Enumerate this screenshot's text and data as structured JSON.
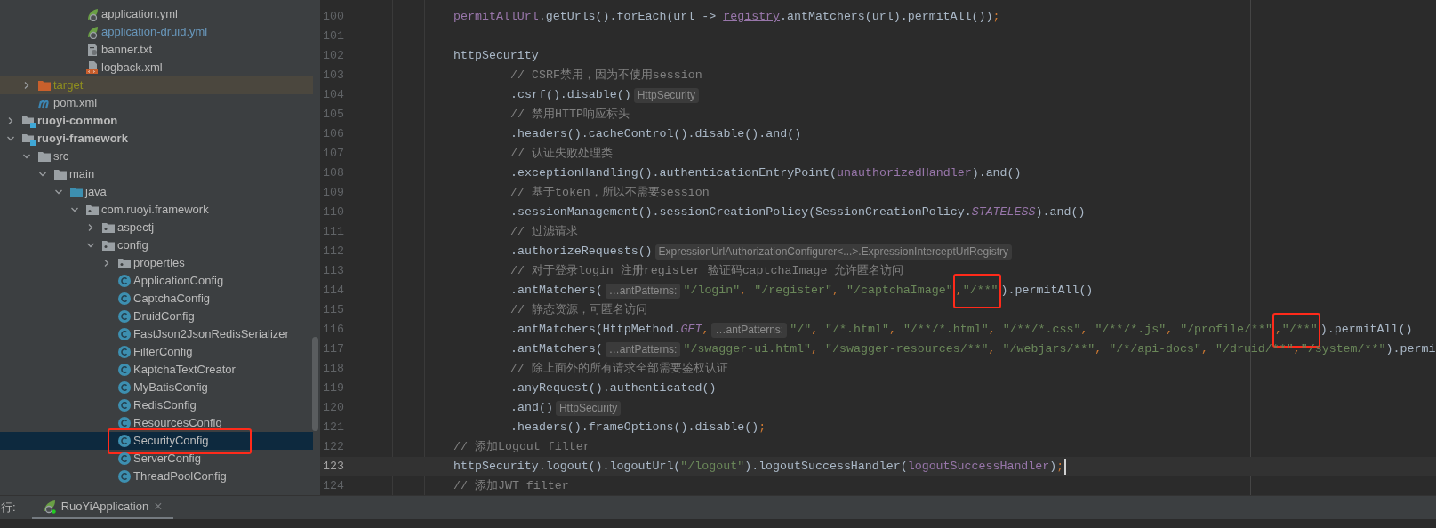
{
  "project_tree": [
    {
      "children": [
        {
          "children": [
            {
              "children": [
                {
                  "children": [
                    {
                      "label": "application.yml",
                      "kind": "spring-config",
                      "selected": false,
                      "modified": false,
                      "annotated": false
                    },
                    {
                      "label": "application-druid.yml",
                      "kind": "spring-config",
                      "selected": false,
                      "modified": true,
                      "annotated": false
                    },
                    {
                      "label": "banner.txt",
                      "kind": "text-file",
                      "selected": false,
                      "modified": false,
                      "annotated": false
                    },
                    {
                      "label": "logback.xml",
                      "kind": "xml-file",
                      "selected": false,
                      "modified": false,
                      "annotated": false
                    }
                  ]
                }
              ]
            }
          ]
        },
        {
          "label": "target",
          "kind": "excluded-folder",
          "expanded": false,
          "selected": false,
          "modified": false,
          "annotated": false
        },
        {
          "label": "pom.xml",
          "kind": "maven-file",
          "selected": false,
          "modified": false,
          "annotated": false
        }
      ]
    },
    {
      "label": "ruoyi-common",
      "kind": "module",
      "expanded": false,
      "selected": false,
      "modified": false,
      "annotated": false
    },
    {
      "label": "ruoyi-framework",
      "kind": "module",
      "expanded": true,
      "selected": false,
      "modified": false,
      "annotated": false,
      "children": [
        {
          "label": "src",
          "kind": "folder",
          "expanded": true,
          "selected": false,
          "modified": false,
          "annotated": false,
          "children": [
            {
              "label": "main",
              "kind": "folder",
              "expanded": true,
              "selected": false,
              "modified": false,
              "annotated": false,
              "children": [
                {
                  "label": "java",
                  "kind": "source-root",
                  "expanded": true,
                  "selected": false,
                  "modified": false,
                  "annotated": false,
                  "children": [
                    {
                      "label": "com.ruoyi.framework",
                      "kind": "package",
                      "expanded": true,
                      "selected": false,
                      "modified": false,
                      "annotated": false,
                      "children": [
                        {
                          "label": "aspectj",
                          "kind": "package",
                          "expanded": false,
                          "selected": false,
                          "modified": false,
                          "annotated": false
                        },
                        {
                          "label": "config",
                          "kind": "package",
                          "expanded": true,
                          "selected": false,
                          "modified": false,
                          "annotated": false,
                          "children": [
                            {
                              "label": "properties",
                              "kind": "package",
                              "expanded": false,
                              "selected": false,
                              "modified": false,
                              "annotated": false
                            },
                            {
                              "label": "ApplicationConfig",
                              "kind": "class",
                              "selected": false,
                              "modified": false,
                              "annotated": false
                            },
                            {
                              "label": "CaptchaConfig",
                              "kind": "class",
                              "selected": false,
                              "modified": false,
                              "annotated": false
                            },
                            {
                              "label": "DruidConfig",
                              "kind": "class",
                              "selected": false,
                              "modified": false,
                              "annotated": false
                            },
                            {
                              "label": "FastJson2JsonRedisSerializer",
                              "kind": "class",
                              "selected": false,
                              "modified": false,
                              "annotated": false
                            },
                            {
                              "label": "FilterConfig",
                              "kind": "class",
                              "selected": false,
                              "modified": false,
                              "annotated": false
                            },
                            {
                              "label": "KaptchaTextCreator",
                              "kind": "class",
                              "selected": false,
                              "modified": false,
                              "annotated": false
                            },
                            {
                              "label": "MyBatisConfig",
                              "kind": "class",
                              "selected": false,
                              "modified": false,
                              "annotated": false
                            },
                            {
                              "label": "RedisConfig",
                              "kind": "class",
                              "selected": false,
                              "modified": false,
                              "annotated": false
                            },
                            {
                              "label": "ResourcesConfig",
                              "kind": "class",
                              "selected": false,
                              "modified": false,
                              "annotated": false
                            },
                            {
                              "label": "SecurityConfig",
                              "kind": "class",
                              "selected": true,
                              "modified": false,
                              "annotated": true
                            },
                            {
                              "label": "ServerConfig",
                              "kind": "class",
                              "selected": false,
                              "modified": false,
                              "annotated": false
                            },
                            {
                              "label": "ThreadPoolConfig",
                              "kind": "class",
                              "selected": false,
                              "modified": false,
                              "annotated": false
                            }
                          ]
                        }
                      ]
                    }
                  ]
                }
              ]
            }
          ]
        }
      ]
    }
  ],
  "editor": {
    "lines": [
      {
        "number": "100",
        "current": false,
        "segments": [
          {
            "kind": "code",
            "tokens": [
              {
                "kind": "field",
                "text": "        permitAllUrl"
              },
              {
                "kind": "plain",
                "text": ".getUrls().forEach(url -> "
              },
              {
                "kind": "field_underlined",
                "text": "registry"
              },
              {
                "kind": "plain",
                "text": ".antMatchers(url).permitAll())"
              },
              {
                "kind": "punct",
                "text": ";"
              }
            ]
          }
        ]
      },
      {
        "number": "101",
        "current": false
      },
      {
        "number": "102",
        "current": false,
        "segments": [
          {
            "kind": "code",
            "tokens": [
              {
                "kind": "plain",
                "text": "        httpSecurity"
              }
            ]
          }
        ]
      },
      {
        "number": "103",
        "current": false,
        "segments": [
          {
            "kind": "code",
            "tokens": [
              {
                "kind": "comment",
                "text": "                // CSRF禁用，因为不使用session"
              }
            ]
          }
        ]
      },
      {
        "number": "104",
        "current": false,
        "segments": [
          {
            "kind": "code",
            "tokens": [
              {
                "kind": "plain",
                "text": "                .csrf().disable()"
              }
            ]
          },
          {
            "kind": "hint",
            "text": "HttpSecurity"
          }
        ]
      },
      {
        "number": "105",
        "current": false,
        "segments": [
          {
            "kind": "code",
            "tokens": [
              {
                "kind": "comment",
                "text": "                // 禁用HTTP响应标头"
              }
            ]
          }
        ]
      },
      {
        "number": "106",
        "current": false,
        "segments": [
          {
            "kind": "code",
            "tokens": [
              {
                "kind": "plain",
                "text": "                .headers().cacheControl().disable().and()"
              }
            ]
          }
        ]
      },
      {
        "number": "107",
        "current": false,
        "segments": [
          {
            "kind": "code",
            "tokens": [
              {
                "kind": "comment",
                "text": "                // 认证失败处理类"
              }
            ]
          }
        ]
      },
      {
        "number": "108",
        "current": false,
        "segments": [
          {
            "kind": "code",
            "tokens": [
              {
                "kind": "plain",
                "text": "                .exceptionHandling().authenticationEntryPoint("
              },
              {
                "kind": "field",
                "text": "unauthorizedHandler"
              },
              {
                "kind": "plain",
                "text": ").and()"
              }
            ]
          }
        ]
      },
      {
        "number": "109",
        "current": false,
        "segments": [
          {
            "kind": "code",
            "tokens": [
              {
                "kind": "comment",
                "text": "                // 基于token，所以不需要session"
              }
            ]
          }
        ]
      },
      {
        "number": "110",
        "current": false,
        "segments": [
          {
            "kind": "code",
            "tokens": [
              {
                "kind": "plain",
                "text": "                .sessionManagement().sessionCreationPolicy(SessionCreationPolicy."
              },
              {
                "kind": "constant",
                "text": "STATELESS"
              },
              {
                "kind": "plain",
                "text": ").and()"
              }
            ]
          }
        ]
      },
      {
        "number": "111",
        "current": false,
        "segments": [
          {
            "kind": "code",
            "tokens": [
              {
                "kind": "comment",
                "text": "                // 过滤请求"
              }
            ]
          }
        ]
      },
      {
        "number": "112",
        "current": false,
        "segments": [
          {
            "kind": "code",
            "tokens": [
              {
                "kind": "plain",
                "text": "                .authorizeRequests()"
              }
            ]
          },
          {
            "kind": "hint",
            "text": "ExpressionUrlAuthorizationConfigurer<...>.ExpressionInterceptUrlRegistry"
          }
        ]
      },
      {
        "number": "113",
        "current": false,
        "segments": [
          {
            "kind": "code",
            "tokens": [
              {
                "kind": "comment",
                "text": "                // 对于登录login 注册register 验证码captchaImage 允许匿名访问"
              }
            ]
          }
        ]
      },
      {
        "number": "114",
        "current": false,
        "segments": [
          {
            "kind": "code",
            "tokens": [
              {
                "kind": "plain",
                "text": "                .antMatchers("
              }
            ]
          },
          {
            "kind": "hint",
            "text": "…antPatterns:"
          },
          {
            "kind": "code",
            "tokens": [
              {
                "kind": "string",
                "text": "\"/login\""
              },
              {
                "kind": "punct",
                "text": ", "
              },
              {
                "kind": "string",
                "text": "\"/register\""
              },
              {
                "kind": "punct",
                "text": ", "
              },
              {
                "kind": "string",
                "text": "\"/captchaImage\""
              }
            ]
          },
          {
            "kind": "highlight",
            "tokens": [
              {
                "kind": "punct",
                "text": ","
              },
              {
                "kind": "string",
                "text": "\"/**\""
              }
            ]
          },
          {
            "kind": "code",
            "tokens": [
              {
                "kind": "plain",
                "text": ").permitAll()"
              }
            ]
          }
        ]
      },
      {
        "number": "115",
        "current": false,
        "segments": [
          {
            "kind": "code",
            "tokens": [
              {
                "kind": "comment",
                "text": "                // 静态资源，可匿名访问"
              }
            ]
          }
        ]
      },
      {
        "number": "116",
        "current": false,
        "segments": [
          {
            "kind": "code",
            "tokens": [
              {
                "kind": "plain",
                "text": "                .antMatchers(HttpMethod."
              },
              {
                "kind": "constant",
                "text": "GET"
              },
              {
                "kind": "punct",
                "text": ","
              }
            ]
          },
          {
            "kind": "hint",
            "text": "…antPatterns:"
          },
          {
            "kind": "code",
            "tokens": [
              {
                "kind": "string",
                "text": "\"/\""
              },
              {
                "kind": "punct",
                "text": ", "
              },
              {
                "kind": "string",
                "text": "\"/*.html\""
              },
              {
                "kind": "punct",
                "text": ", "
              },
              {
                "kind": "string",
                "text": "\"/**/*.html\""
              },
              {
                "kind": "punct",
                "text": ", "
              },
              {
                "kind": "string",
                "text": "\"/**/*.css\""
              },
              {
                "kind": "punct",
                "text": ", "
              },
              {
                "kind": "string",
                "text": "\"/**/*.js\""
              },
              {
                "kind": "punct",
                "text": ", "
              },
              {
                "kind": "string",
                "text": "\"/profile/**\""
              }
            ]
          },
          {
            "kind": "highlight",
            "tokens": [
              {
                "kind": "punct",
                "text": ","
              },
              {
                "kind": "string",
                "text": "\"/**\""
              }
            ]
          },
          {
            "kind": "code",
            "tokens": [
              {
                "kind": "plain",
                "text": ").permitAll()"
              }
            ]
          }
        ]
      },
      {
        "number": "117",
        "current": false,
        "segments": [
          {
            "kind": "code",
            "tokens": [
              {
                "kind": "plain",
                "text": "                .antMatchers("
              }
            ]
          },
          {
            "kind": "hint",
            "text": "…antPatterns:"
          },
          {
            "kind": "code",
            "tokens": [
              {
                "kind": "string",
                "text": "\"/swagger-ui.html\""
              },
              {
                "kind": "punct",
                "text": ", "
              },
              {
                "kind": "string",
                "text": "\"/swagger-resources/**\""
              },
              {
                "kind": "punct",
                "text": ", "
              },
              {
                "kind": "string",
                "text": "\"/webjars/**\""
              },
              {
                "kind": "punct",
                "text": ", "
              },
              {
                "kind": "string",
                "text": "\"/*/api-docs\""
              },
              {
                "kind": "punct",
                "text": ", "
              },
              {
                "kind": "string",
                "text": "\"/druid/**\""
              },
              {
                "kind": "punct",
                "text": ","
              },
              {
                "kind": "string",
                "text": "\"/system/**\""
              },
              {
                "kind": "plain",
                "text": ").permi"
              }
            ]
          }
        ]
      },
      {
        "number": "118",
        "current": false,
        "segments": [
          {
            "kind": "code",
            "tokens": [
              {
                "kind": "comment",
                "text": "                // 除上面外的所有请求全部需要鉴权认证"
              }
            ]
          }
        ]
      },
      {
        "number": "119",
        "current": false,
        "segments": [
          {
            "kind": "code",
            "tokens": [
              {
                "kind": "plain",
                "text": "                .anyRequest().authenticated()"
              }
            ]
          }
        ]
      },
      {
        "number": "120",
        "current": false,
        "segments": [
          {
            "kind": "code",
            "tokens": [
              {
                "kind": "plain",
                "text": "                .and()"
              }
            ]
          },
          {
            "kind": "hint",
            "text": "HttpSecurity"
          }
        ]
      },
      {
        "number": "121",
        "current": false,
        "segments": [
          {
            "kind": "code",
            "tokens": [
              {
                "kind": "plain",
                "text": "                .headers().frameOptions().disable()"
              },
              {
                "kind": "punct",
                "text": ";"
              }
            ]
          }
        ]
      },
      {
        "number": "122",
        "current": false,
        "segments": [
          {
            "kind": "code",
            "tokens": [
              {
                "kind": "comment",
                "text": "        // 添加Logout filter"
              }
            ]
          }
        ]
      },
      {
        "number": "123",
        "current": true,
        "segments": [
          {
            "kind": "code",
            "tokens": [
              {
                "kind": "plain",
                "text": "        httpSecurity.logout().logoutUrl("
              },
              {
                "kind": "string",
                "text": "\"/logout\""
              },
              {
                "kind": "plain",
                "text": ").logoutSuccessHandler("
              },
              {
                "kind": "field",
                "text": "logoutSuccessHandler"
              },
              {
                "kind": "plain",
                "text": ")"
              },
              {
                "kind": "punct",
                "text": ";"
              }
            ]
          }
        ]
      },
      {
        "number": "124",
        "current": false,
        "segments": [
          {
            "kind": "code",
            "tokens": [
              {
                "kind": "comment",
                "text": "        // 添加JWT filter"
              }
            ]
          }
        ]
      }
    ]
  },
  "run_panel": {
    "label": "行:",
    "tabs": [
      {
        "label": "RuoYiApplication",
        "selected": true,
        "close": "×"
      }
    ]
  }
}
